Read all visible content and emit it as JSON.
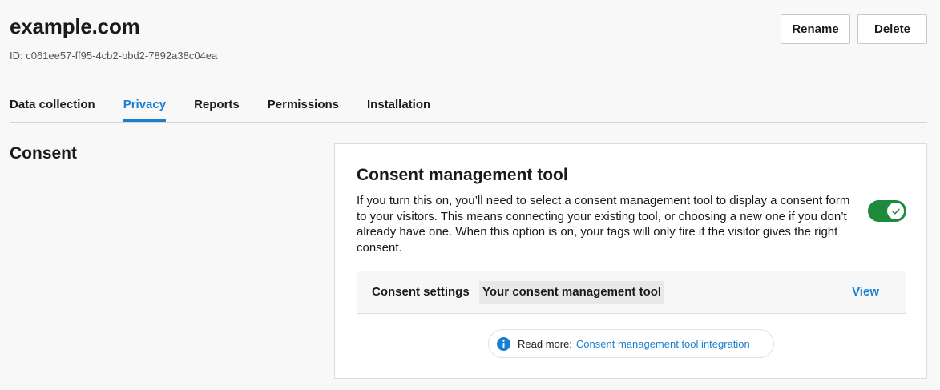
{
  "header": {
    "title": "example.com",
    "id_text": "ID: c061ee57-ff95-4cb2-bbd2-7892a38c04ea",
    "rename_label": "Rename",
    "delete_label": "Delete"
  },
  "tabs": [
    {
      "label": "Data collection",
      "active": false
    },
    {
      "label": "Privacy",
      "active": true
    },
    {
      "label": "Reports",
      "active": false
    },
    {
      "label": "Permissions",
      "active": false
    },
    {
      "label": "Installation",
      "active": false
    }
  ],
  "section": {
    "title": "Consent"
  },
  "card": {
    "title": "Consent management tool",
    "description": "If you turn this on, you’ll need to select a consent management tool to display a consent form to your visitors. This means connecting your existing tool, or choosing a new one if you don’t already have one. When this option is on, your tags will only fire if the visitor gives the right consent.",
    "toggle_on": true,
    "settings_label": "Consent settings",
    "settings_value": "Your consent management tool",
    "view_label": "View",
    "readmore_label": "Read more:",
    "readmore_link": "Consent management tool integration"
  },
  "colors": {
    "accent": "#1a7fd0",
    "toggle_on": "#1e8a3c",
    "background": "#f8f8f8"
  },
  "icons": {
    "toggle_check": "check-icon",
    "info": "info-icon"
  }
}
